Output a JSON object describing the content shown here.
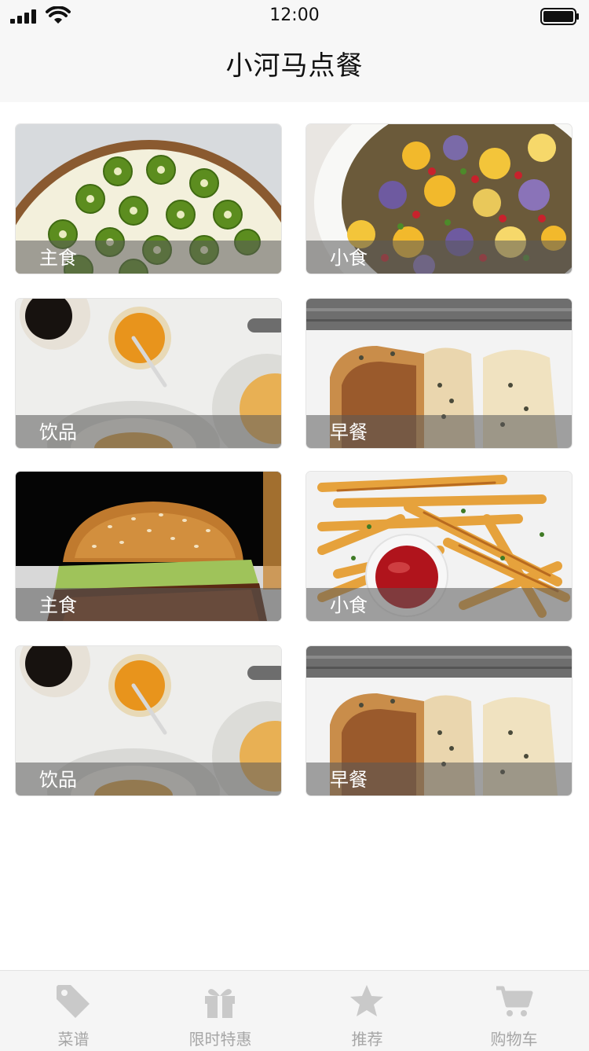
{
  "status_bar": {
    "time": "12:00"
  },
  "nav": {
    "title": "小河马点餐"
  },
  "cards": [
    {
      "label": "主食",
      "photo_icon": "kiwi-tart"
    },
    {
      "label": "小食",
      "photo_icon": "cauliflower-salad"
    },
    {
      "label": "饮品",
      "photo_icon": "coffee-honey"
    },
    {
      "label": "早餐",
      "photo_icon": "bread"
    },
    {
      "label": "主食",
      "photo_icon": "burger"
    },
    {
      "label": "小食",
      "photo_icon": "fries-ketchup"
    },
    {
      "label": "饮品",
      "photo_icon": "coffee-honey"
    },
    {
      "label": "早餐",
      "photo_icon": "bread"
    }
  ],
  "tabs": [
    {
      "label": "菜谱",
      "icon": "tag-icon"
    },
    {
      "label": "限时特惠",
      "icon": "gift-icon"
    },
    {
      "label": "推荐",
      "icon": "star-icon"
    },
    {
      "label": "购物车",
      "icon": "cart-icon"
    }
  ],
  "colors": {
    "bar_background": "#f7f7f7",
    "tab_inactive": "#a6a6a6",
    "caption_overlay": "rgba(90,90,90,0.55)"
  }
}
